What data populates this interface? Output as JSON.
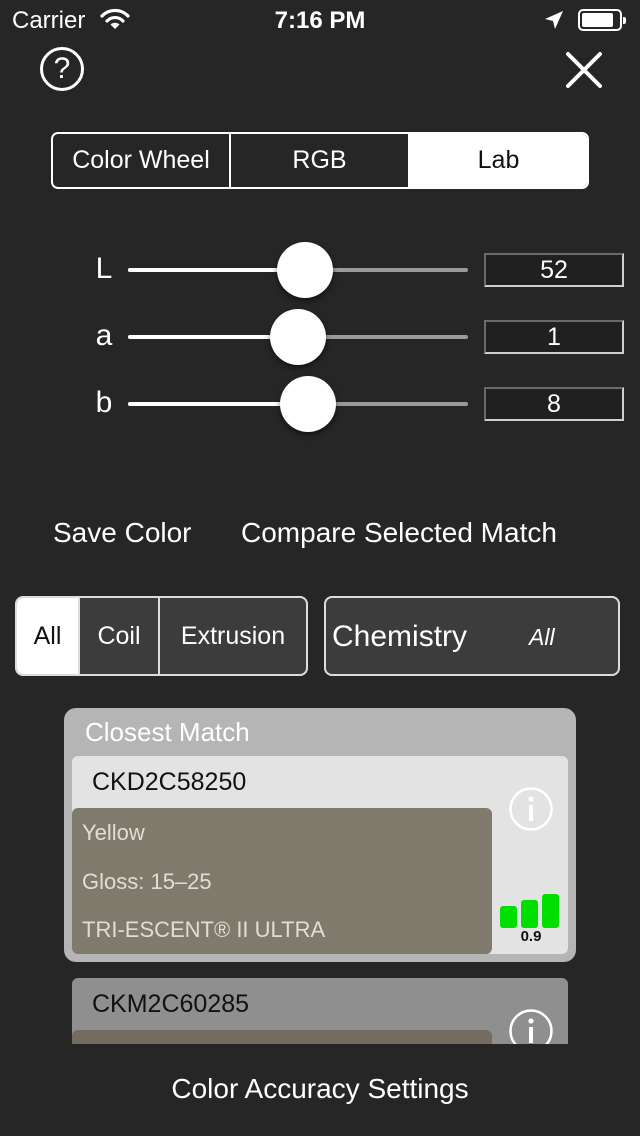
{
  "status": {
    "carrier": "Carrier",
    "time": "7:16 PM",
    "icons": [
      "wifi-icon",
      "location-arrow-icon",
      "battery-icon"
    ],
    "battery_level": 0.85
  },
  "header": {
    "help_label": "?",
    "icons": [
      "help-icon",
      "close-icon"
    ]
  },
  "mode_tabs": [
    {
      "label": "Color Wheel",
      "active": false
    },
    {
      "label": "RGB",
      "active": false
    },
    {
      "label": "Lab",
      "active": true
    }
  ],
  "sliders": [
    {
      "label": "L",
      "value": "52",
      "min": 0,
      "max": 100,
      "position": 0.52
    },
    {
      "label": "a",
      "value": "1",
      "min": -128,
      "max": 127,
      "position": 0.5
    },
    {
      "label": "b",
      "value": "8",
      "min": -128,
      "max": 127,
      "position": 0.53
    }
  ],
  "actions": {
    "save": "Save Color",
    "compare": "Compare Selected Match"
  },
  "filter_tabs": [
    {
      "label": "All",
      "active": true
    },
    {
      "label": "Coil",
      "active": false
    },
    {
      "label": "Extrusion",
      "active": false
    }
  ],
  "chemistry": {
    "label": "Chemistry",
    "value": "All"
  },
  "results": {
    "group_title": "Closest Match",
    "matches": [
      {
        "code": "CKD2C58250",
        "color_name": "Yellow",
        "gloss": "Gloss: 15–25",
        "product": "TRI-ESCENT® II ULTRA",
        "score": "0.9",
        "swatch_color": "#807a6c",
        "bar_color": "#00e000"
      },
      {
        "code": "CKM2C60285",
        "swatch_color": "#746c60"
      }
    ]
  },
  "footer": {
    "settings_link": "Color Accuracy Settings"
  },
  "colors": {
    "background": "#262626",
    "accent_white": "#ffffff",
    "match_indicator": "#00e000"
  }
}
